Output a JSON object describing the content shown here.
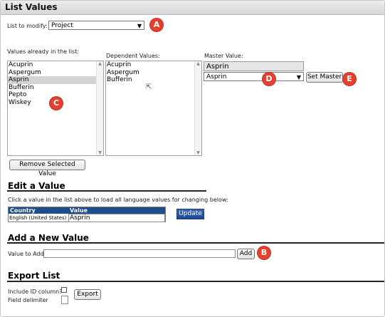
{
  "window": {
    "title": "List Values"
  },
  "list_modify": {
    "label": "List to modify:",
    "selected": "Project"
  },
  "values_list": {
    "label": "Values already in the list:",
    "items": [
      "Acuprin",
      "Aspergum",
      "Asprin",
      "Bufferin",
      "Pepto",
      "Wiskey"
    ],
    "selected": "Asprin"
  },
  "dependent": {
    "label": "Dependent Values:",
    "items": [
      "Acuprin",
      "Aspergum",
      "Bufferin"
    ]
  },
  "master": {
    "label": "Master Value:",
    "current": "Asprin",
    "select_value": "Asprin",
    "set_button": "Set Master"
  },
  "remove_button": "Remove Selected Value",
  "edit": {
    "heading": "Edit a Value",
    "instructions": "Click a value in the list above to load all language values for changing below:",
    "col_country": "Country",
    "col_value": "Value",
    "row_country": "English (United States)",
    "row_value": "Asprin",
    "update_button": "Update"
  },
  "add": {
    "heading": "Add a New Value",
    "label": "Value to Add:",
    "value": "",
    "button": "Add"
  },
  "export": {
    "heading": "Export List",
    "include_id_label": "Include ID column?",
    "delimiter_label": "Field delimiter",
    "button": "Export"
  },
  "markers": [
    "A",
    "B",
    "C",
    "D",
    "E"
  ],
  "colors": {
    "marker": "#e3402f",
    "header_blue": "#1d4e8a"
  }
}
